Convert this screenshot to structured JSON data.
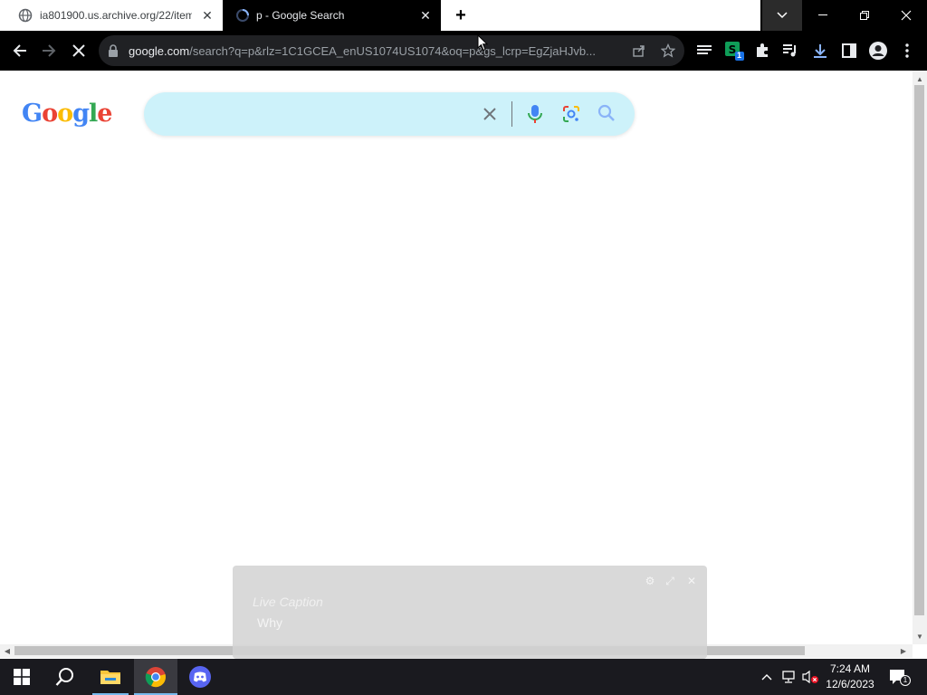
{
  "tabs": [
    {
      "title": "ia801900.us.archive.org/22/items/",
      "close": "✕",
      "icon": "globe-icon",
      "active": false
    },
    {
      "title": "p - Google Search",
      "close": "✕",
      "icon": "loading-spinner-icon",
      "active": true
    }
  ],
  "new_tab_label": "+",
  "window_controls": {
    "dropdown": "tab-search-icon",
    "minimize": "minimize-icon",
    "restore": "restore-icon",
    "close": "close-icon"
  },
  "toolbar": {
    "back": "back-arrow-icon",
    "forward": "forward-arrow-icon",
    "stop": "stop-loading-icon",
    "url_host": "google.com",
    "url_rest": "/search?q=p&rlz=1C1GCEA_enUS1074US1074&oq=p&gs_lcrp=EgZjaHJvb...",
    "extension_badge": "1"
  },
  "google": {
    "logo_letters": [
      "G",
      "o",
      "o",
      "g",
      "l",
      "e"
    ],
    "logo_colors": [
      "#4285f4",
      "#ea4335",
      "#fbbc05",
      "#4285f4",
      "#34a853",
      "#ea4335"
    ],
    "search_value": "",
    "searchbox_color": "#cdf2fa"
  },
  "live_caption": {
    "title": "Live Caption",
    "text": "Why"
  },
  "taskbar": {
    "apps": [
      "start-icon",
      "search-icon",
      "file-explorer-icon",
      "chrome-icon",
      "discord-icon"
    ],
    "time": "7:24 AM",
    "date": "12/6/2023",
    "notification_count": "1"
  }
}
